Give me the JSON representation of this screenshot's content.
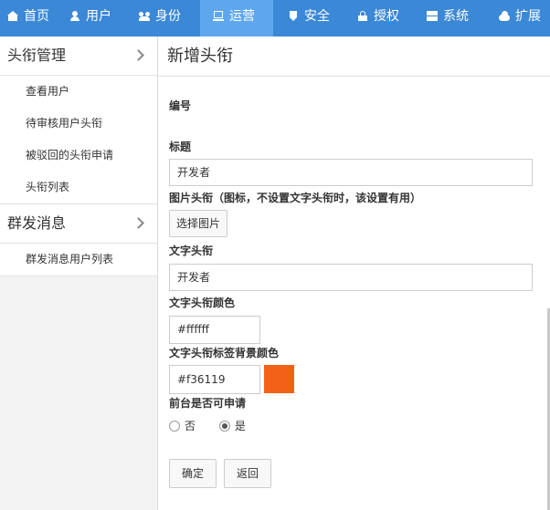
{
  "nav": {
    "items": [
      {
        "label": "首页",
        "icon": "home-icon"
      },
      {
        "label": "用户",
        "icon": "user-icon"
      },
      {
        "label": "身份",
        "icon": "users-icon"
      },
      {
        "label": "运营",
        "icon": "laptop-icon",
        "active": true
      },
      {
        "label": "安全",
        "icon": "shield-icon"
      },
      {
        "label": "授权",
        "icon": "lock-icon"
      },
      {
        "label": "系统",
        "icon": "grid-icon"
      },
      {
        "label": "扩展",
        "icon": "cloud-icon"
      }
    ]
  },
  "sidebar": {
    "groups": [
      {
        "title": "头衔管理",
        "items": [
          "查看用户",
          "待审核用户头衔",
          "被驳回的头衔申请",
          "头衔列表"
        ]
      },
      {
        "title": "群发消息",
        "items": [
          "群发消息用户列表"
        ]
      }
    ]
  },
  "main": {
    "title": "新增头衔",
    "form": {
      "id_label": "编号",
      "title_label": "标题",
      "title_value": "开发者",
      "image_label": "图片头衔（图标，不设置文字头衔时，该设置有用）",
      "choose_image": "选择图片",
      "text_label": "文字头衔",
      "text_value": "开发者",
      "color_label": "文字头衔颜色",
      "color_value": "#ffffff",
      "bg_label": "文字头衔标签背景颜色",
      "bg_value": "#f36119",
      "apply_label": "前台是否可申请",
      "option_no": "否",
      "option_yes": "是",
      "selected": "是",
      "confirm": "确定",
      "back": "返回"
    }
  },
  "colors": {
    "nav_bg": "#3b88d6",
    "nav_active": "#5ea7ee",
    "text_color_swatch": "#ffffff",
    "bg_color_swatch": "#f36119"
  }
}
